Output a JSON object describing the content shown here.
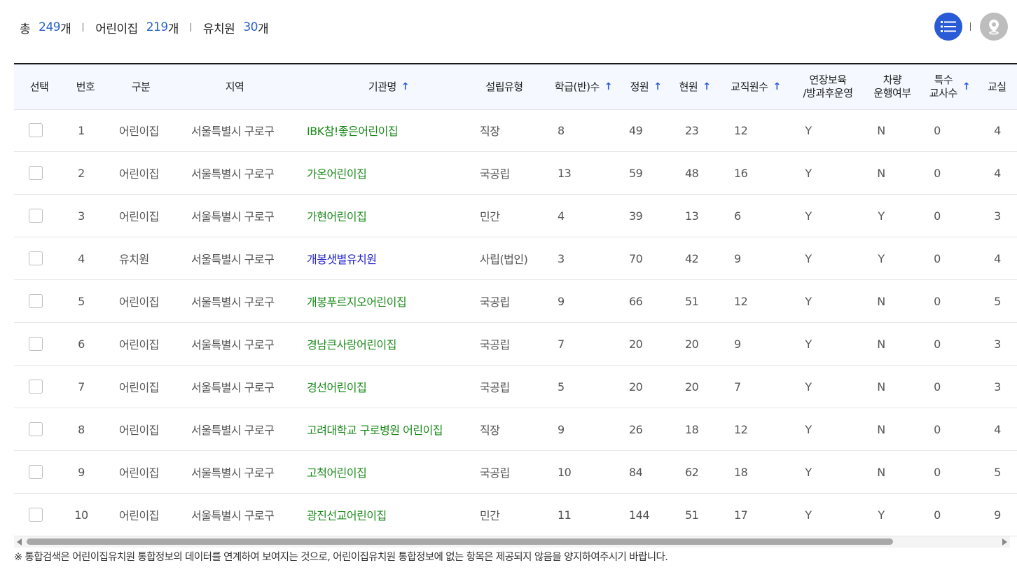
{
  "summary": {
    "total_label": "총",
    "total_count": "249",
    "total_unit": "개",
    "daycare_label": "어린이집",
    "daycare_count": "219",
    "daycare_unit": "개",
    "kinder_label": "유치원",
    "kinder_count": "30",
    "kinder_unit": "개"
  },
  "colors": {
    "accent": "#2a5bd7",
    "count": "#2a64c8",
    "daycare_name": "#1a8a1a",
    "kinder_name": "#2222cc"
  },
  "icons": {
    "list_view": "list-icon",
    "map_view": "map-pin-icon",
    "sort": "arrow-up-icon"
  },
  "columns": {
    "select": "선택",
    "no": "번호",
    "type": "구분",
    "region": "지역",
    "name": "기관명",
    "estab": "설립유형",
    "classes": "학급(반)수",
    "capacity": "정원",
    "current": "현원",
    "staff": "교직원수",
    "extended_l1": "연장보육",
    "extended_l2": "/방과후운영",
    "vehicle_l1": "차량",
    "vehicle_l2": "운행여부",
    "special_l1": "특수",
    "special_l2": "교사수",
    "rooms": "교실"
  },
  "rows": [
    {
      "no": "1",
      "type": "어린이집",
      "region": "서울특별시 구로구",
      "name": "IBK참!좋은어린이집",
      "estab": "직장",
      "classes": "8",
      "capacity": "49",
      "current": "23",
      "staff": "12",
      "extended": "Y",
      "vehicle": "N",
      "special": "0",
      "rooms": "4"
    },
    {
      "no": "2",
      "type": "어린이집",
      "region": "서울특별시 구로구",
      "name": "가온어린이집",
      "estab": "국공립",
      "classes": "13",
      "capacity": "59",
      "current": "48",
      "staff": "16",
      "extended": "Y",
      "vehicle": "N",
      "special": "0",
      "rooms": "4"
    },
    {
      "no": "3",
      "type": "어린이집",
      "region": "서울특별시 구로구",
      "name": "가현어린이집",
      "estab": "민간",
      "classes": "4",
      "capacity": "39",
      "current": "13",
      "staff": "6",
      "extended": "Y",
      "vehicle": "Y",
      "special": "0",
      "rooms": "3"
    },
    {
      "no": "4",
      "type": "유치원",
      "region": "서울특별시 구로구",
      "name": "개봉샛별유치원",
      "estab": "사립(법인)",
      "classes": "3",
      "capacity": "70",
      "current": "42",
      "staff": "9",
      "extended": "Y",
      "vehicle": "Y",
      "special": "0",
      "rooms": "4"
    },
    {
      "no": "5",
      "type": "어린이집",
      "region": "서울특별시 구로구",
      "name": "개봉푸르지오어린이집",
      "estab": "국공립",
      "classes": "9",
      "capacity": "66",
      "current": "51",
      "staff": "12",
      "extended": "Y",
      "vehicle": "N",
      "special": "0",
      "rooms": "5"
    },
    {
      "no": "6",
      "type": "어린이집",
      "region": "서울특별시 구로구",
      "name": "경남큰사랑어린이집",
      "estab": "국공립",
      "classes": "7",
      "capacity": "20",
      "current": "20",
      "staff": "9",
      "extended": "Y",
      "vehicle": "N",
      "special": "0",
      "rooms": "3"
    },
    {
      "no": "7",
      "type": "어린이집",
      "region": "서울특별시 구로구",
      "name": "경선어린이집",
      "estab": "국공립",
      "classes": "5",
      "capacity": "20",
      "current": "20",
      "staff": "7",
      "extended": "Y",
      "vehicle": "N",
      "special": "0",
      "rooms": "3"
    },
    {
      "no": "8",
      "type": "어린이집",
      "region": "서울특별시 구로구",
      "name": "고려대학교 구로병원 어린이집",
      "estab": "직장",
      "classes": "9",
      "capacity": "26",
      "current": "18",
      "staff": "12",
      "extended": "Y",
      "vehicle": "N",
      "special": "0",
      "rooms": "4"
    },
    {
      "no": "9",
      "type": "어린이집",
      "region": "서울특별시 구로구",
      "name": "고척어린이집",
      "estab": "국공립",
      "classes": "10",
      "capacity": "84",
      "current": "62",
      "staff": "18",
      "extended": "Y",
      "vehicle": "N",
      "special": "0",
      "rooms": "5"
    },
    {
      "no": "10",
      "type": "어린이집",
      "region": "서울특별시 구로구",
      "name": "광진선교어린이집",
      "estab": "민간",
      "classes": "11",
      "capacity": "144",
      "current": "51",
      "staff": "17",
      "extended": "Y",
      "vehicle": "Y",
      "special": "0",
      "rooms": "9"
    }
  ],
  "footnote": "※ 통합검색은 어린이집유치원 통합정보의 데이터를 연계하여 보여지는 것으로, 어린이집유치원 통합정보에 없는 항목은 제공되지 않음을 양지하여주시기 바랍니다."
}
